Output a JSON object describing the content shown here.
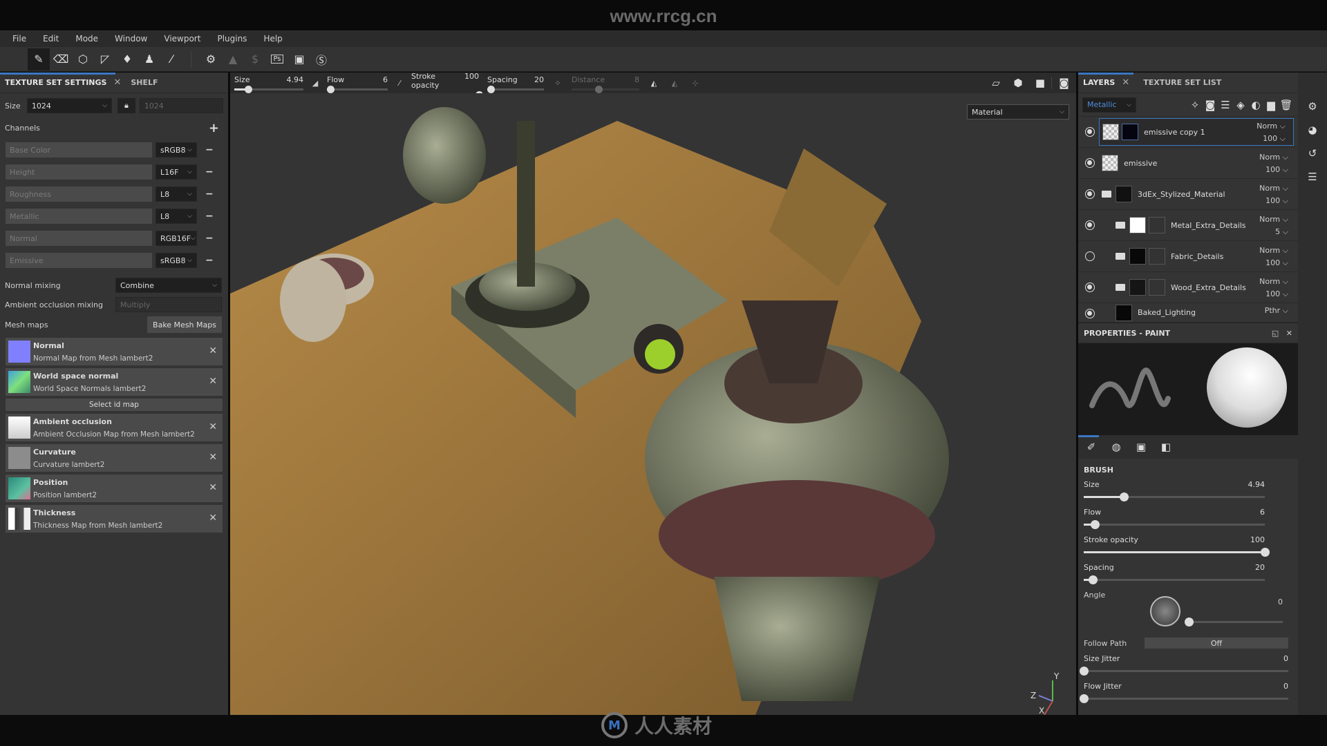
{
  "watermark_top": "www.rrcg.cn",
  "watermark_bottom": "人人素材",
  "menu": [
    "File",
    "Edit",
    "Mode",
    "Window",
    "Viewport",
    "Plugins",
    "Help"
  ],
  "toolbar": {
    "tools": [
      "paint-brush",
      "eraser",
      "projection",
      "polygon-fill",
      "smudge",
      "clone-stamp",
      "color-picker"
    ],
    "plugins": [
      "substance-share",
      "notification",
      "substance-source",
      "photoshop-export",
      "iray",
      "substance-logo"
    ]
  },
  "left_panel": {
    "tabs": [
      {
        "label": "TEXTURE SET SETTINGS"
      },
      {
        "label": "SHELF"
      }
    ],
    "size_label": "Size",
    "size_value": "1024",
    "size_locked_value": "1024",
    "channels_label": "Channels",
    "channels": [
      {
        "name": "Base Color",
        "format": "sRGB8"
      },
      {
        "name": "Height",
        "format": "L16F"
      },
      {
        "name": "Roughness",
        "format": "L8"
      },
      {
        "name": "Metallic",
        "format": "L8"
      },
      {
        "name": "Normal",
        "format": "RGB16F"
      },
      {
        "name": "Emissive",
        "format": "sRGB8"
      }
    ],
    "normal_mixing_label": "Normal mixing",
    "normal_mixing_value": "Combine",
    "ao_mixing_label": "Ambient occlusion mixing",
    "ao_mixing_value": "Multiply",
    "mesh_maps_label": "Mesh maps",
    "bake_button": "Bake Mesh Maps",
    "mesh_maps": [
      {
        "title": "Normal",
        "subtitle": "Normal Map from Mesh lambert2",
        "color": "#8080ff"
      },
      {
        "title": "World space normal",
        "subtitle": "World Space Normals lambert2",
        "color": "#4fb08a"
      },
      {
        "title": "Ambient occlusion",
        "subtitle": "Ambient Occlusion Map from Mesh lambert2",
        "color": "#e8e8e8"
      },
      {
        "title": "Curvature",
        "subtitle": "Curvature lambert2",
        "color": "#8c8c8c"
      },
      {
        "title": "Position",
        "subtitle": "Position lambert2",
        "color": "#3c9a7a"
      },
      {
        "title": "Thickness",
        "subtitle": "Thickness Map from Mesh lambert2",
        "color": "#d0d0d0"
      }
    ],
    "select_id_map": "Select id map"
  },
  "context_toolbar": {
    "size": {
      "label": "Size",
      "value": "4.94",
      "fraction": 0.2
    },
    "flow": {
      "label": "Flow",
      "value": "6",
      "fraction": 0.06
    },
    "stroke_opacity": {
      "label": "Stroke opacity",
      "value": "100",
      "fraction": 1.0
    },
    "spacing": {
      "label": "Spacing",
      "value": "20",
      "fraction": 0.06
    },
    "distance": {
      "label": "Distance",
      "value": "8",
      "fraction": 0.4
    }
  },
  "viewport": {
    "display_mode": "Material",
    "axes": [
      "Y",
      "Z",
      "X"
    ]
  },
  "layers_panel": {
    "tabs": [
      {
        "label": "LAYERS"
      },
      {
        "label": "TEXTURE SET LIST"
      }
    ],
    "channel_filter": "Metallic",
    "layers": [
      {
        "name": "emissive copy 1",
        "blend": "Norm",
        "opacity": "100",
        "visible": true,
        "selected": true,
        "type": "fill"
      },
      {
        "name": "emissive",
        "blend": "Norm",
        "opacity": "100",
        "visible": true,
        "type": "fill"
      },
      {
        "name": "3dEx_Stylized_Material",
        "blend": "Norm",
        "opacity": "100",
        "visible": true,
        "type": "folder-open"
      },
      {
        "name": "Metal_Extra_Details",
        "blend": "Norm",
        "opacity": "5",
        "visible": true,
        "type": "folder"
      },
      {
        "name": "Fabric_Details",
        "blend": "Norm",
        "opacity": "100",
        "visible": false,
        "type": "folder"
      },
      {
        "name": "Wood_Extra_Details",
        "blend": "Norm",
        "opacity": "100",
        "visible": true,
        "type": "folder"
      },
      {
        "name": "Baked_Lighting",
        "blend": "Pthr",
        "opacity": "",
        "visible": true,
        "type": "paint"
      }
    ]
  },
  "properties": {
    "title": "PROPERTIES - PAINT",
    "section": "BRUSH",
    "size": {
      "label": "Size",
      "value": "4.94",
      "fraction": 0.22
    },
    "flow": {
      "label": "Flow",
      "value": "6",
      "fraction": 0.06
    },
    "stroke_opacity": {
      "label": "Stroke opacity",
      "value": "100",
      "fraction": 1.0
    },
    "spacing": {
      "label": "Spacing",
      "value": "20",
      "fraction": 0.05
    },
    "angle": {
      "label": "Angle",
      "value": "0"
    },
    "follow_path": {
      "label": "Follow Path",
      "value": "Off"
    },
    "size_jitter": {
      "label": "Size Jitter",
      "value": "0",
      "fraction": 0
    },
    "flow_jitter": {
      "label": "Flow Jitter",
      "value": "0",
      "fraction": 0
    }
  }
}
